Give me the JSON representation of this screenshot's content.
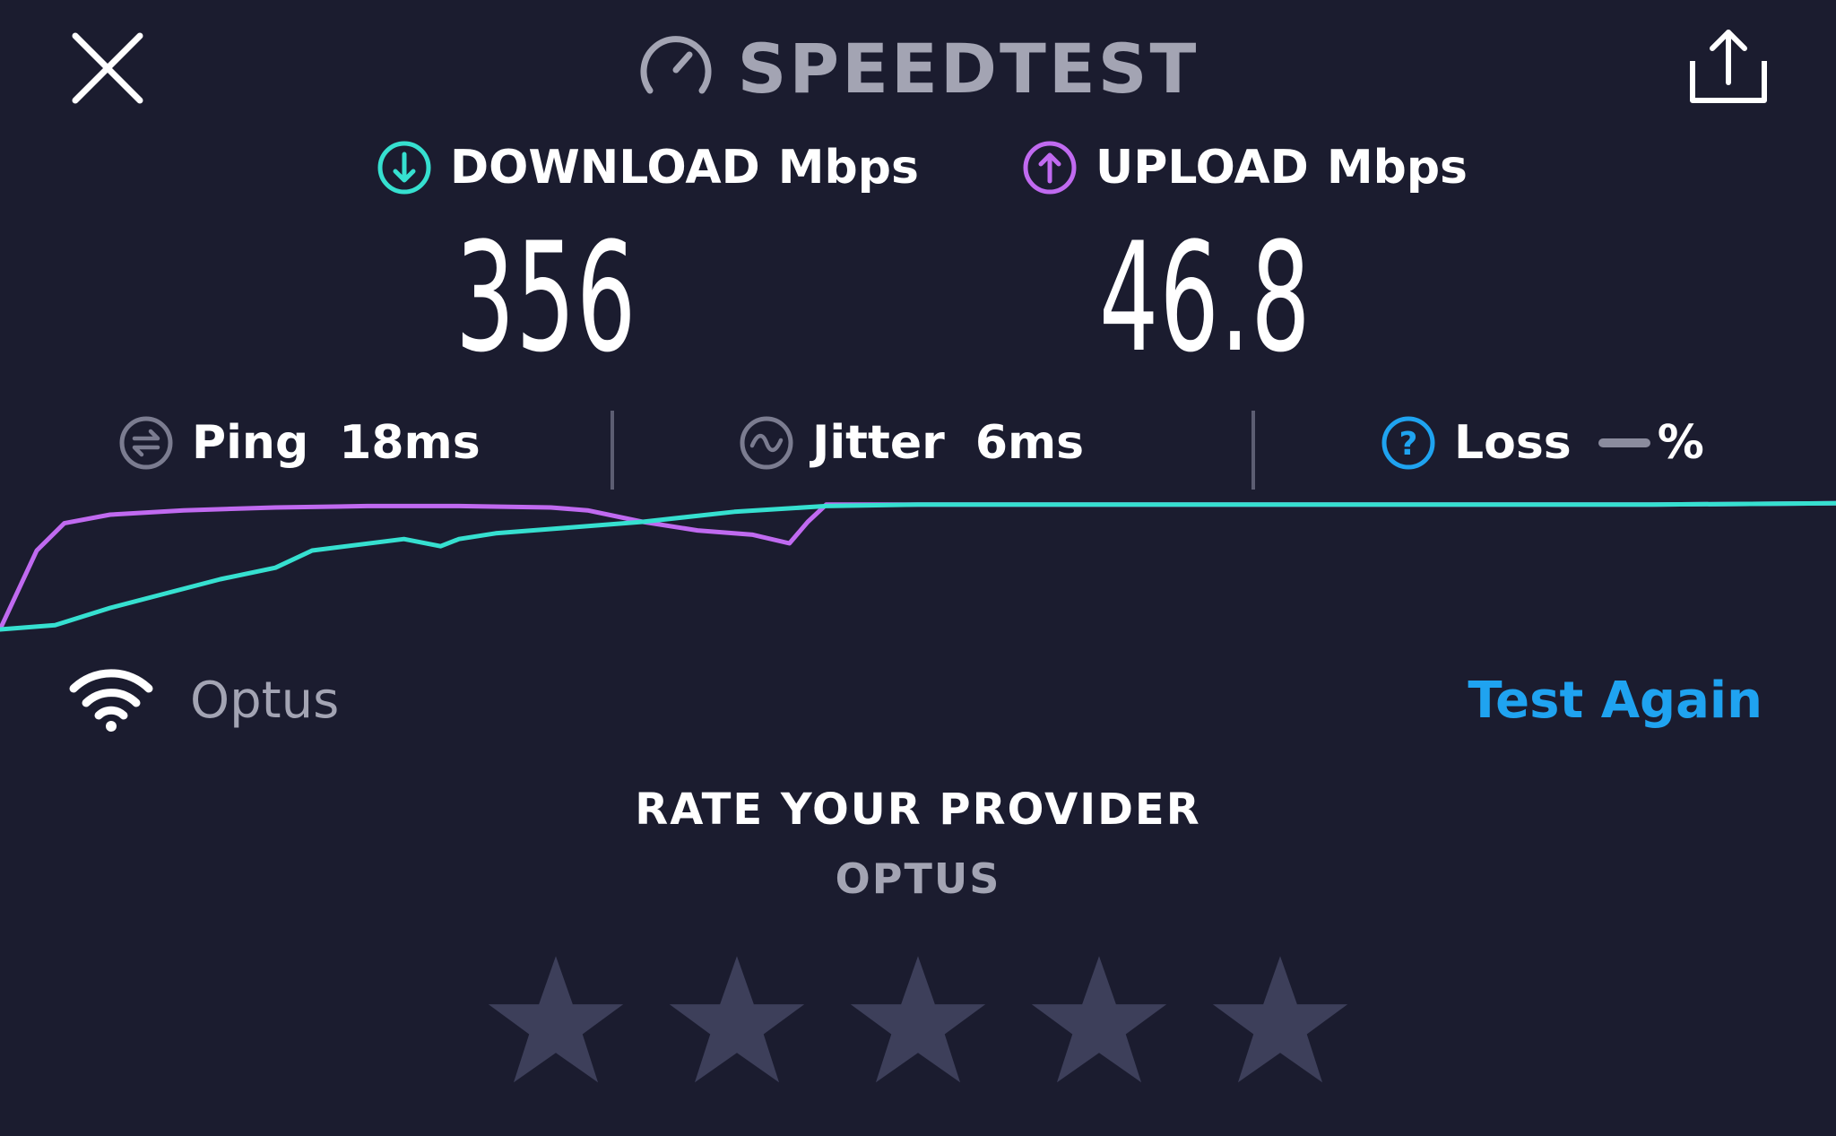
{
  "header": {
    "brand": "SPEEDTEST",
    "icons": {
      "close": "close-icon",
      "share": "share-icon",
      "brand": "speedometer-icon"
    }
  },
  "results": {
    "download": {
      "label": "DOWNLOAD",
      "unit": "Mbps",
      "value": "356",
      "icon": "download-arrow-icon",
      "color": "#36e0d0"
    },
    "upload": {
      "label": "UPLOAD",
      "unit": "Mbps",
      "value": "46.8",
      "icon": "upload-arrow-icon",
      "color": "#c06af0"
    }
  },
  "stats": {
    "ping": {
      "label": "Ping",
      "value": "18ms",
      "icon": "ping-icon"
    },
    "jitter": {
      "label": "Jitter",
      "value": "6ms",
      "icon": "jitter-icon"
    },
    "loss": {
      "label": "Loss",
      "value": "%",
      "icon": "help-icon",
      "color": "#1fa3f0"
    }
  },
  "connection": {
    "provider": "Optus",
    "icon": "wifi-icon",
    "test_again_label": "Test Again"
  },
  "rating": {
    "title": "RATE YOUR PROVIDER",
    "provider": "OPTUS",
    "max_stars": 5,
    "selected": 0,
    "star_color": "#3d3f5a"
  },
  "chart_data": {
    "type": "line",
    "title": "",
    "xlabel": "",
    "ylabel": "",
    "grid": false,
    "x_range": [
      0,
      1
    ],
    "y_range": [
      0,
      1
    ],
    "series": [
      {
        "color": "#c06af0",
        "x": [
          0.0,
          0.02,
          0.035,
          0.06,
          0.1,
          0.15,
          0.2,
          0.25,
          0.3,
          0.32,
          0.35,
          0.38,
          0.41,
          0.43,
          0.44,
          0.45,
          0.5,
          0.6,
          0.7,
          0.8,
          0.9,
          1.0
        ],
        "y": [
          0.05,
          0.6,
          0.79,
          0.85,
          0.88,
          0.9,
          0.91,
          0.91,
          0.9,
          0.88,
          0.8,
          0.74,
          0.71,
          0.65,
          0.8,
          0.92,
          0.92,
          0.92,
          0.92,
          0.92,
          0.92,
          0.93
        ]
      },
      {
        "color": "#36e0d0",
        "x": [
          0.0,
          0.03,
          0.06,
          0.09,
          0.12,
          0.15,
          0.17,
          0.22,
          0.24,
          0.25,
          0.27,
          0.3,
          0.35,
          0.4,
          0.45,
          0.5,
          0.6,
          0.7,
          0.8,
          0.9,
          1.0
        ],
        "y": [
          0.05,
          0.08,
          0.2,
          0.3,
          0.4,
          0.48,
          0.6,
          0.68,
          0.63,
          0.68,
          0.72,
          0.75,
          0.8,
          0.87,
          0.91,
          0.92,
          0.92,
          0.92,
          0.92,
          0.92,
          0.93
        ]
      }
    ]
  }
}
